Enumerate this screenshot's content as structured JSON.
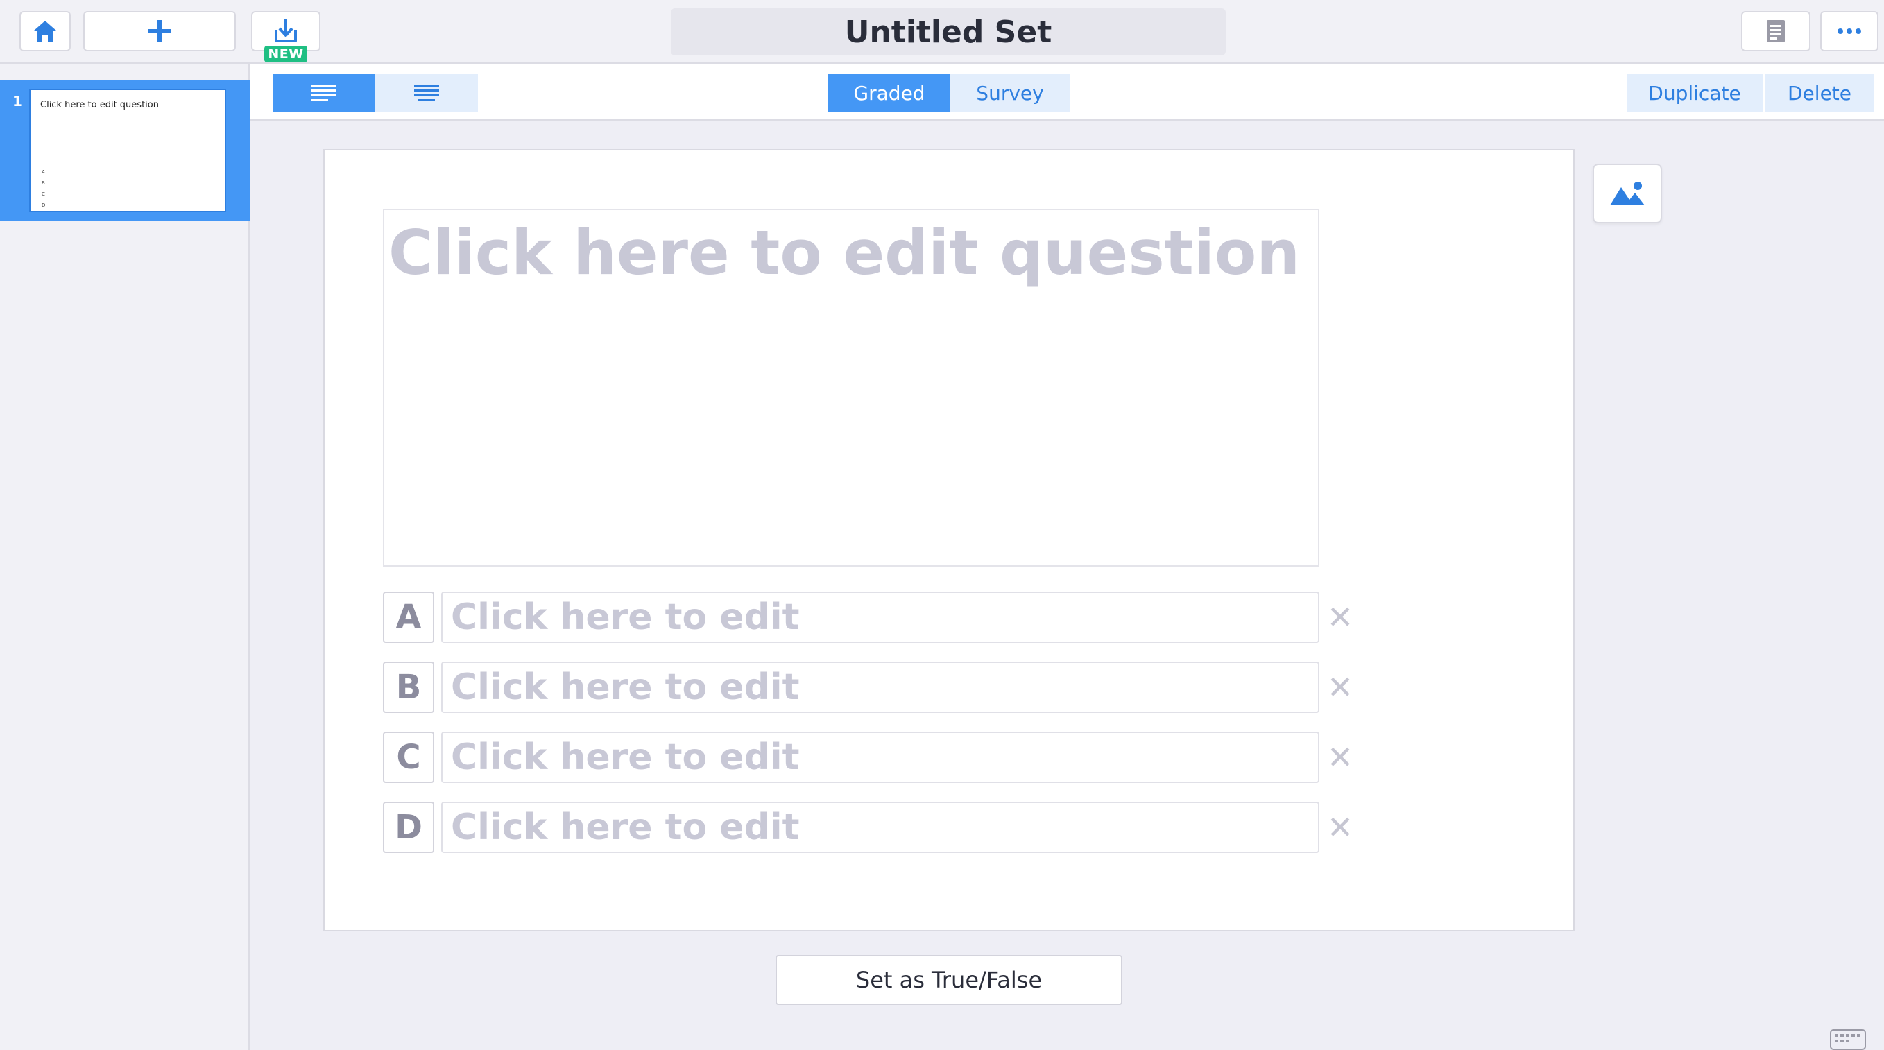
{
  "header": {
    "title": "Untitled Set",
    "new_badge": "NEW",
    "icons": {
      "home": "home-icon",
      "add": "plus-icon",
      "import": "download-icon",
      "notes": "document-icon",
      "more": "ellipsis-icon"
    }
  },
  "sidebar": {
    "slides": [
      {
        "number": "1",
        "question": "Click here to edit question",
        "options": [
          "A",
          "B",
          "C",
          "D"
        ]
      }
    ]
  },
  "toolbar": {
    "align_buttons": [
      "align-left-icon",
      "align-center-icon"
    ],
    "mode_tabs": [
      {
        "label": "Graded",
        "active": true
      },
      {
        "label": "Survey",
        "active": false
      }
    ],
    "duplicate_label": "Duplicate",
    "delete_label": "Delete"
  },
  "editor": {
    "question_placeholder": "Click here to edit question",
    "options": [
      {
        "letter": "A",
        "placeholder": "Click here to edit"
      },
      {
        "letter": "B",
        "placeholder": "Click here to edit"
      },
      {
        "letter": "C",
        "placeholder": "Click here to edit"
      },
      {
        "letter": "D",
        "placeholder": "Click here to edit"
      }
    ],
    "remove_glyph": "✕",
    "true_false_label": "Set as True/False"
  },
  "colors": {
    "accent": "#4497f5",
    "accent_light": "#e3eefc",
    "badge_green": "#1fbf83",
    "placeholder": "#c8c8d6",
    "background": "#eeeef5"
  }
}
